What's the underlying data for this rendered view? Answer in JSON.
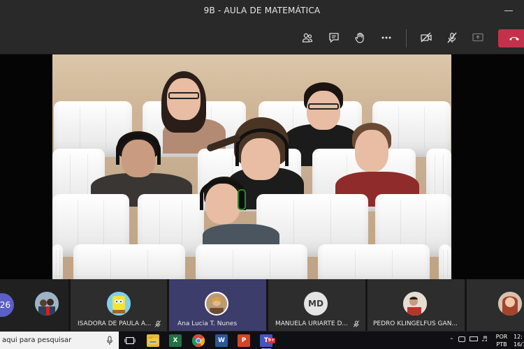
{
  "window": {
    "title": "9B - AULA DE MATEMÁTICA"
  },
  "toolbar": {
    "items": [
      "participants-icon",
      "chat-icon",
      "raise-hand-icon",
      "more-icon",
      "camera-off-icon",
      "mic-off-icon",
      "share-icon",
      "hang-up-icon"
    ]
  },
  "participants_strip": {
    "overflow_count": "26",
    "tiles": [
      {
        "name": "",
        "initials": "",
        "mic_muted": false
      },
      {
        "name": "ISADORA DE PAULA A...",
        "initials": "",
        "mic_muted": true
      },
      {
        "name": "Ana Lucia T. Nunes",
        "initials": "",
        "mic_muted": false,
        "active": true
      },
      {
        "name": "MANUELA URIARTE D...",
        "initials": "MD",
        "mic_muted": true
      },
      {
        "name": "PEDRO KLINGELFUS GAN...",
        "initials": "",
        "mic_muted": false
      },
      {
        "name": "",
        "initials": "",
        "mic_muted": false
      }
    ]
  },
  "taskbar": {
    "search_text": "aqui para pesquisar",
    "apps": [
      "task-view-icon",
      "file-explorer-icon",
      "excel-icon",
      "chrome-icon",
      "word-icon",
      "powerpoint-icon",
      "teams-icon"
    ],
    "teams_badge": "9+",
    "language_top": "POR",
    "language_bottom": "PTB",
    "time": "12:",
    "date": "16/1"
  },
  "colors": {
    "accent": "#5b5fc7",
    "hangup": "#c4314b",
    "active_tile": "#3d3d6b"
  }
}
